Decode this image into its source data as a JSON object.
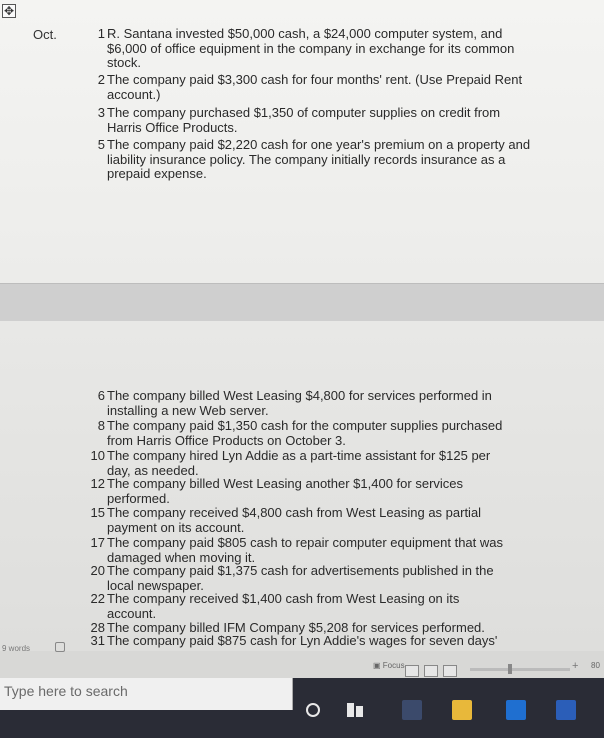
{
  "document": {
    "table_handle_icon": "table-move-handle-icon",
    "month": "Oct.",
    "transactions_top": [
      {
        "day": "1",
        "text": "R. Santana invested $50,000 cash, a $24,000 computer system, and $6,000 of office equipment in the company in exchange for its common stock."
      },
      {
        "day": "2",
        "text": "The company paid $3,300 cash for four months' rent. (Use Prepaid Rent account.)"
      },
      {
        "day": "3",
        "text": "The company purchased $1,350 of computer supplies on credit from Harris Office Products."
      },
      {
        "day": "5",
        "text": "The company paid $2,220 cash for one year's premium on a property and liability insurance policy. The company initially records insurance as a prepaid expense."
      }
    ],
    "transactions_bottom": [
      {
        "day": "6",
        "text": "The company billed West Leasing $4,800 for services performed in installing a new Web server."
      },
      {
        "day": "8",
        "text": "The company paid $1,350 cash for the computer supplies purchased from Harris Office Products on October 3."
      },
      {
        "day": "10",
        "text": "The company hired Lyn Addie as a part-time assistant for $125 per day, as needed."
      },
      {
        "day": "12",
        "text": "The company billed West Leasing another $1,400 for services performed."
      },
      {
        "day": "15",
        "text": "The company received $4,800 cash from West Leasing as partial payment on its account."
      },
      {
        "day": "17",
        "text": "The company paid $805 cash to repair computer equipment that was damaged when moving it."
      },
      {
        "day": "20",
        "text": "The company paid $1,375 cash for advertisements published in the local newspaper."
      },
      {
        "day": "22",
        "text": "The company received $1,400 cash from West Leasing on its account."
      },
      {
        "day": "28",
        "text": "The company billed IFM Company $5,208 for services performed."
      },
      {
        "day": "31",
        "text": "The company paid $875 cash for Lyn Addie's wages for seven days'"
      }
    ]
  },
  "status_bar": {
    "word_count": "9 words",
    "focus_label": "Focus",
    "zoom_level": "80"
  },
  "taskbar": {
    "search_placeholder": "Type here to search"
  },
  "colors": {
    "taskbar": "#2a2c36",
    "page": "#eeeeec"
  }
}
